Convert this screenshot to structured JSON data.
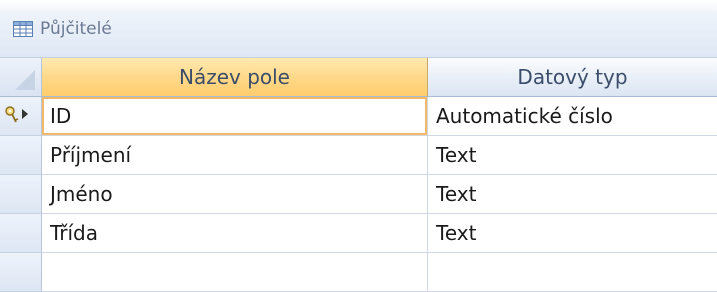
{
  "window": {
    "title": "Půjčitelé",
    "icon": "table-icon"
  },
  "columns": {
    "field_name": "Název pole",
    "data_type": "Datový typ"
  },
  "rows": [
    {
      "field_name": "ID",
      "data_type": "Automatické číslo",
      "primary_key": true,
      "selected": true
    },
    {
      "field_name": "Příjmení",
      "data_type": "Text"
    },
    {
      "field_name": "Jméno",
      "data_type": "Text"
    },
    {
      "field_name": "Třída",
      "data_type": "Text"
    },
    {
      "field_name": "",
      "data_type": ""
    }
  ],
  "colors": {
    "header_accent": "#ffd98a",
    "selection_border": "#f4b869",
    "title_text": "#6b7a92"
  }
}
